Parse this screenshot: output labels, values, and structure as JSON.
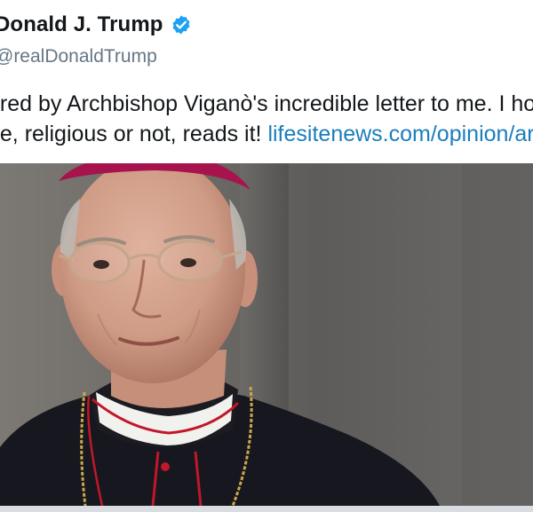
{
  "user": {
    "display_name": "Donald J. Trump",
    "handle": "@realDonaldTrump",
    "verified_icon": "verified-badge-icon"
  },
  "tweet": {
    "line1": "ored by Archbishop Viganò's incredible letter to me. I hop",
    "line2_text": "ne, religious or not, reads it! ",
    "line2_link": "lifesitenews.com/opinion/arc"
  },
  "colors": {
    "text": "#14171a",
    "handle": "#657786",
    "link": "#1b7dbc",
    "verified": "#1da1f2",
    "cassock": "#17171f",
    "piping": "#c0182a"
  },
  "media": {
    "subject": "portrait-photo"
  }
}
